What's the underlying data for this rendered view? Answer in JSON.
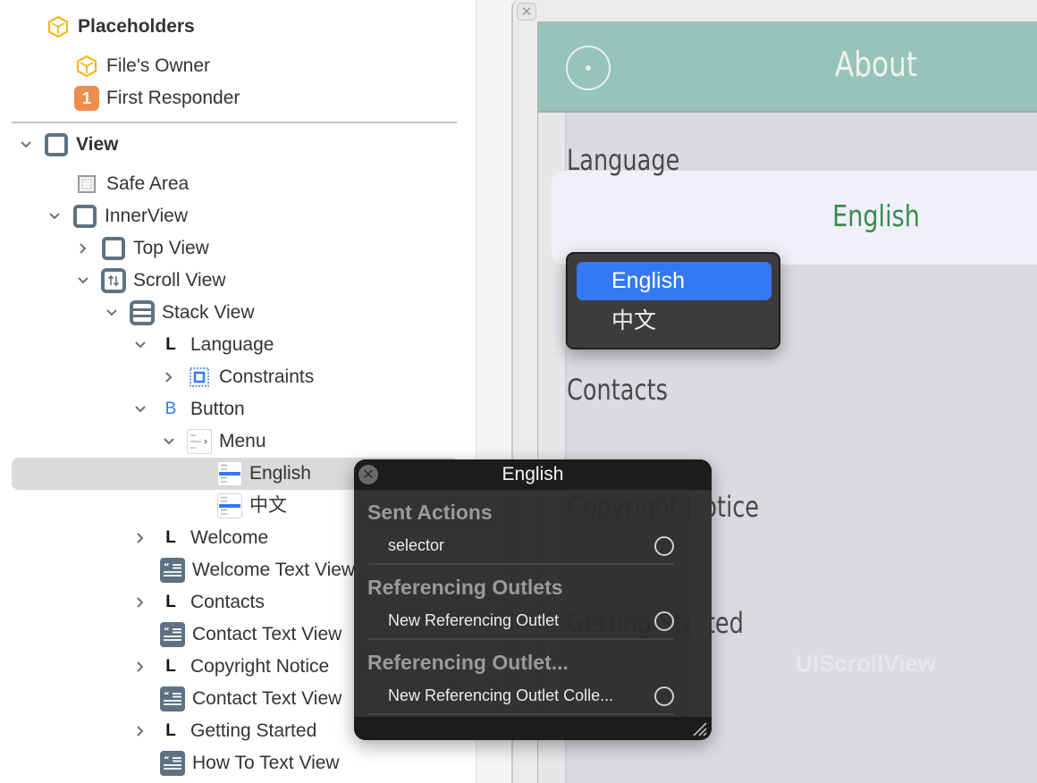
{
  "outline": {
    "placeholders_header": "Placeholders",
    "items": [
      {
        "id": "files-owner",
        "label": "File's Owner",
        "icon": "cube-icon"
      },
      {
        "id": "first-responder",
        "label": "First Responder",
        "icon": "first-responder-icon",
        "badge": "1"
      },
      {
        "id": "view",
        "label": "View",
        "icon": "view-icon",
        "expanded": true
      },
      {
        "id": "safe-area",
        "label": "Safe Area",
        "icon": "safe-area-icon"
      },
      {
        "id": "innerview",
        "label": "InnerView",
        "icon": "view-icon",
        "expanded": true
      },
      {
        "id": "top-view",
        "label": "Top View",
        "icon": "view-icon",
        "expanded": false
      },
      {
        "id": "scroll-view",
        "label": "Scroll View",
        "icon": "scroll-view-icon",
        "expanded": true
      },
      {
        "id": "stack-view",
        "label": "Stack View",
        "icon": "stack-view-icon",
        "expanded": true
      },
      {
        "id": "language",
        "label": "Language",
        "icon": "label-icon",
        "glyph": "L",
        "expanded": true
      },
      {
        "id": "constraints",
        "label": "Constraints",
        "icon": "constraints-icon",
        "expanded": false
      },
      {
        "id": "button",
        "label": "Button",
        "icon": "button-icon",
        "glyph": "B",
        "expanded": true
      },
      {
        "id": "menu",
        "label": "Menu",
        "icon": "menu-icon",
        "expanded": true
      },
      {
        "id": "english",
        "label": "English",
        "icon": "menu-item-icon",
        "selected": true
      },
      {
        "id": "chinese",
        "label": "中文",
        "icon": "menu-item-icon"
      },
      {
        "id": "welcome",
        "label": "Welcome",
        "icon": "label-icon",
        "glyph": "L",
        "expanded": false
      },
      {
        "id": "welcome-text-view",
        "label": "Welcome Text View",
        "icon": "text-view-icon"
      },
      {
        "id": "contacts",
        "label": "Contacts",
        "icon": "label-icon",
        "glyph": "L",
        "expanded": false
      },
      {
        "id": "contact-text-view-1",
        "label": "Contact Text View",
        "icon": "text-view-icon"
      },
      {
        "id": "copyright-notice",
        "label": "Copyright Notice",
        "icon": "label-icon",
        "glyph": "L",
        "expanded": false
      },
      {
        "id": "contact-text-view-2",
        "label": "Contact Text View",
        "icon": "text-view-icon"
      },
      {
        "id": "getting-started",
        "label": "Getting Started",
        "icon": "label-icon",
        "glyph": "L",
        "expanded": false
      },
      {
        "id": "how-to-text-view",
        "label": "How To Text View",
        "icon": "text-view-icon"
      }
    ]
  },
  "scene": {
    "nav_title": "About",
    "language_label": "Language",
    "language_button_title": "English",
    "contacts_label": "Contacts",
    "copyright_label": "Copyright Notice",
    "getting_started_label": "Getting Started",
    "scroll_view_watermark": "UIScrollView",
    "colors": {
      "nav_bar": "#97c4b8",
      "button_text": "#3a8a52",
      "menu_selection": "#3478f6"
    }
  },
  "popup_menu": {
    "items": [
      {
        "label": "English",
        "selected": true
      },
      {
        "label": "中文",
        "selected": false
      }
    ]
  },
  "connections_hud": {
    "title": "English",
    "sections": [
      {
        "header": "Sent Actions",
        "rows": [
          "selector"
        ]
      },
      {
        "header": "Referencing Outlets",
        "rows": [
          "New Referencing Outlet"
        ]
      },
      {
        "header": "Referencing Outlet...",
        "rows": [
          "New Referencing Outlet Colle..."
        ]
      }
    ]
  }
}
